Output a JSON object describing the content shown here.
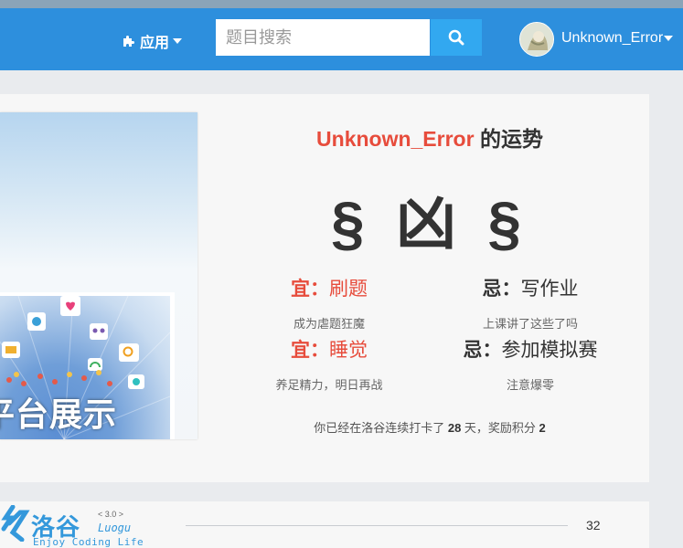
{
  "navbar": {
    "apps_label": "应用",
    "search_placeholder": "题目搜索",
    "username": "Unknown_Error"
  },
  "banner": {
    "text": "平台展示"
  },
  "fortune": {
    "title_user": "Unknown_Error",
    "title_suffix": " 的运势",
    "result": "§ 凶 §",
    "items": [
      {
        "type": "good",
        "label": "宜：",
        "activity": "刷题",
        "desc": "成为虐题狂魔"
      },
      {
        "type": "bad",
        "label": "忌：",
        "activity": "写作业",
        "desc": "上课讲了这些了吗"
      },
      {
        "type": "good",
        "label": "宜：",
        "activity": "睡觉",
        "desc": "养足精力，明日再战"
      },
      {
        "type": "bad",
        "label": "忌：",
        "activity": "参加模拟赛",
        "desc": "注意爆零"
      }
    ],
    "footer": {
      "prefix": "你已经在洛谷连续打卡了 ",
      "days": "28",
      "mid": " 天，奖励积分 ",
      "points": "2"
    }
  },
  "footer_card": {
    "logo_name": "洛谷",
    "logo_version": "< 3.0 >",
    "logo_sub": "Luogu",
    "logo_slogan": "Enjoy Coding Life",
    "count": "32"
  },
  "colors": {
    "navbar": "#2d8fdd",
    "accent_red": "#e74c3c",
    "brand_blue": "#3498db"
  }
}
